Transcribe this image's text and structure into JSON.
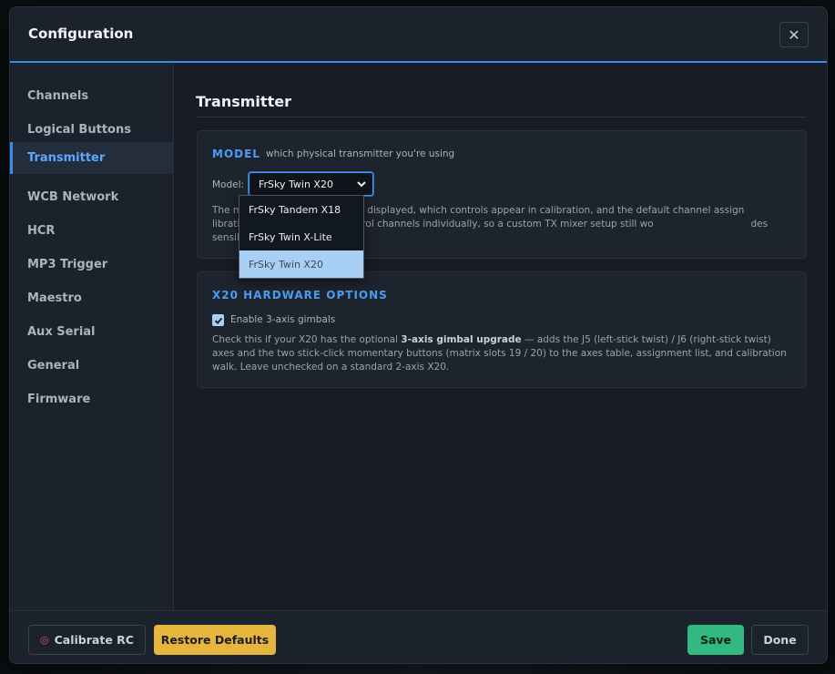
{
  "dialog": {
    "title": "Configuration",
    "close_glyph": "✕"
  },
  "sidebar": {
    "items": [
      {
        "label": "Channels"
      },
      {
        "label": "Logical Buttons"
      },
      {
        "label": "Transmitter"
      },
      {
        "label": "WCB Network"
      },
      {
        "label": "HCR"
      },
      {
        "label": "MP3 Trigger"
      },
      {
        "label": "Maestro"
      },
      {
        "label": "Aux Serial"
      },
      {
        "label": "General"
      },
      {
        "label": "Firmware"
      }
    ],
    "active": "Transmitter"
  },
  "main": {
    "section_title": "Transmitter",
    "model_card": {
      "heading": "MODEL",
      "subtitle": "which physical transmitter you're using",
      "field_label": "Model:",
      "selected_value": "FrSky Twin X20",
      "description": "The mo                                 s is displayed, which controls appear in calibration, and the default channel assign                                libration still overrides per-control channels individually, so a custom TX mixer setup still wo                                des sensible starting points.",
      "options": [
        "FrSky Tandem X18",
        "FrSky Twin X-Lite",
        "FrSky Twin X20"
      ]
    },
    "x20_card": {
      "heading": "X20 HARDWARE OPTIONS",
      "checkbox_label": "Enable 3-axis gimbals",
      "checkbox_checked": true,
      "desc_part1": "Check this if your X20 has the optional ",
      "desc_bold": "3-axis gimbal upgrade",
      "desc_part2": " — adds the J5 (left-stick twist) / J6 (right-stick twist) axes and the two stick-click momentary buttons (matrix slots 19 / 20) to the axes table, assignment list, and calibration walk. Leave unchecked on a standard 2-axis X20."
    }
  },
  "footer": {
    "calibrate_label": "Calibrate RC",
    "restore_label": "Restore Defaults",
    "save_label": "Save",
    "done_label": "Done"
  },
  "colors": {
    "accent": "#3b8de8",
    "restore": "#e5b53e",
    "save": "#31b980"
  }
}
